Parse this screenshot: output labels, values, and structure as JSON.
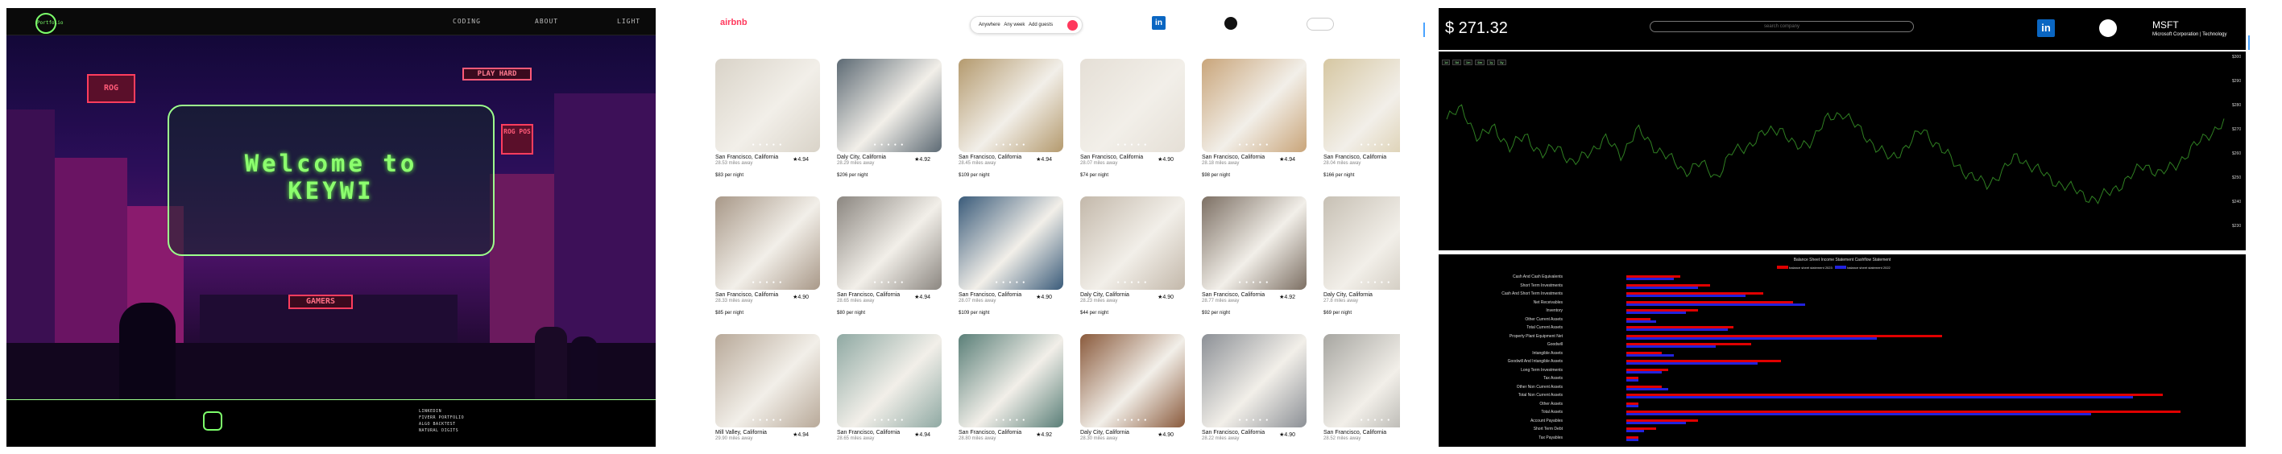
{
  "portfolio": {
    "logo_text": "Portfolio",
    "nav": [
      "CODING",
      "ABOUT",
      "LIGHT"
    ],
    "hero": {
      "welcome_line1": "Welcome to",
      "welcome_line2": "KEYWI",
      "sign_left": "ROG",
      "sign_top_right": "PLAY HARD",
      "sign_mid_right": "ROG POS",
      "sign_center": "GAMERS"
    },
    "footer_links": [
      "LINKEDIN",
      "FIVERR PORTFOLIO",
      "ALGO BACKTEST",
      "NATURAL DIGITS"
    ]
  },
  "airbnb": {
    "logo": "airbnb",
    "search": {
      "anywhere": "Anywhere",
      "anyweek": "Any week",
      "guests": "Add guests"
    },
    "listings": [
      {
        "city": "San Francisco, California",
        "rating": "4.94",
        "distance": "28.53 miles away",
        "price": "$83 per night",
        "color": "#d9d3c8"
      },
      {
        "city": "Daly City, California",
        "rating": "4.92",
        "distance": "28.29 miles away",
        "price": "$206 per night",
        "color": "#5d6a74"
      },
      {
        "city": "San Francisco, California",
        "rating": "4.94",
        "distance": "28.45 miles away",
        "price": "$109 per night",
        "color": "#b49a6e"
      },
      {
        "city": "San Francisco, California",
        "rating": "4.90",
        "distance": "28.07 miles away",
        "price": "$74 per night",
        "color": "#e5dfd6"
      },
      {
        "city": "San Francisco, California",
        "rating": "4.94",
        "distance": "28.18 miles away",
        "price": "$98 per night",
        "color": "#c9a57a"
      },
      {
        "city": "San Francisco, California",
        "rating": "",
        "distance": "28.04 miles away",
        "price": "$166 per night",
        "color": "#d6c7a2"
      },
      {
        "city": "San Francisco, California",
        "rating": "4.90",
        "distance": "28.33 miles away",
        "price": "$85 per night",
        "color": "#a89888"
      },
      {
        "city": "San Francisco, California",
        "rating": "4.94",
        "distance": "28.65 miles away",
        "price": "$80 per night",
        "color": "#8b8680"
      },
      {
        "city": "San Francisco, California",
        "rating": "4.90",
        "distance": "28.07 miles away",
        "price": "$109 per night",
        "color": "#3a5b7a"
      },
      {
        "city": "Daly City, California",
        "rating": "4.90",
        "distance": "28.23 miles away",
        "price": "$44 per night",
        "color": "#c3b8aa"
      },
      {
        "city": "San Francisco, California",
        "rating": "4.92",
        "distance": "28.77 miles away",
        "price": "$92 per night",
        "color": "#7c6f63"
      },
      {
        "city": "Daly City, California",
        "rating": "4.98",
        "distance": "27.8 miles away",
        "price": "$69 per night",
        "color": "#c7c0b4"
      },
      {
        "city": "Mill Valley, California",
        "rating": "4.94",
        "distance": "29.90 miles away",
        "price": "",
        "color": "#b8a999"
      },
      {
        "city": "San Francisco, California",
        "rating": "4.94",
        "distance": "28.65 miles away",
        "price": "",
        "color": "#8fa9a3"
      },
      {
        "city": "San Francisco, California",
        "rating": "4.92",
        "distance": "28.80 miles away",
        "price": "",
        "color": "#5a7f78"
      },
      {
        "city": "Daly City, California",
        "rating": "4.90",
        "distance": "28.30 miles away",
        "price": "",
        "color": "#8a5a3c"
      },
      {
        "city": "San Francisco, California",
        "rating": "4.90",
        "distance": "28.22 miles away",
        "price": "",
        "color": "#8c9096"
      },
      {
        "city": "San Francisco, California",
        "rating": "",
        "distance": "28.52 miles away",
        "price": "",
        "color": "#a7a6a1"
      }
    ]
  },
  "stocks": {
    "price": "$ 271.32",
    "search_placeholder": "search company",
    "ticker": "MSFT",
    "company": "Microsoft Corporation | Technology",
    "tabs_text": "Balance Sheet  Income Statement  Cashflow Statement",
    "legend": [
      "balance sheet statement 2023",
      "balance sheet statement 2022"
    ],
    "legend_colors": [
      "#e00000",
      "#2222dd"
    ],
    "range_buttons": [
      "1d",
      "5d",
      "1m",
      "6m",
      "1y",
      "5y"
    ],
    "y_ticks": [
      "$300",
      "$290",
      "$280",
      "$270",
      "$260",
      "$250",
      "$240",
      "$230"
    ],
    "fin_labels": [
      "Cash And Cash Equivalents",
      "Short Term Investments",
      "Cash And Short Term Investments",
      "Net Receivables",
      "Inventory",
      "Other Current Assets",
      "Total Current Assets",
      "Property Plant Equipment Net",
      "Goodwill",
      "Intangible Assets",
      "Goodwill And Intangible Assets",
      "Long Term Investments",
      "Tax Assets",
      "Other Non Current Assets",
      "Total Non Current Assets",
      "Other Assets",
      "Total Assets",
      "Account Payables",
      "Short Term Debt",
      "Tax Payables"
    ],
    "fin_values_2023": [
      0.09,
      0.14,
      0.23,
      0.28,
      0.12,
      0.04,
      0.18,
      0.53,
      0.21,
      0.06,
      0.26,
      0.07,
      0.02,
      0.06,
      0.9,
      0.02,
      0.93,
      0.12,
      0.05,
      0.02
    ],
    "fin_values_2022": [
      0.08,
      0.12,
      0.2,
      0.3,
      0.1,
      0.05,
      0.17,
      0.42,
      0.15,
      0.08,
      0.22,
      0.06,
      0.02,
      0.07,
      0.85,
      0.02,
      0.78,
      0.1,
      0.03,
      0.02
    ],
    "chart_values": [
      0.66,
      0.72,
      0.55,
      0.62,
      0.5,
      0.58,
      0.46,
      0.52,
      0.41,
      0.49,
      0.55,
      0.47,
      0.6,
      0.52,
      0.45,
      0.38,
      0.42,
      0.35,
      0.48,
      0.52,
      0.58,
      0.62,
      0.5,
      0.55,
      0.66,
      0.7,
      0.6,
      0.52,
      0.44,
      0.52,
      0.6,
      0.52,
      0.42,
      0.36,
      0.3,
      0.38,
      0.46,
      0.4,
      0.34,
      0.3,
      0.26,
      0.22,
      0.28,
      0.34,
      0.42,
      0.36,
      0.42,
      0.5,
      0.58,
      0.64
    ]
  }
}
